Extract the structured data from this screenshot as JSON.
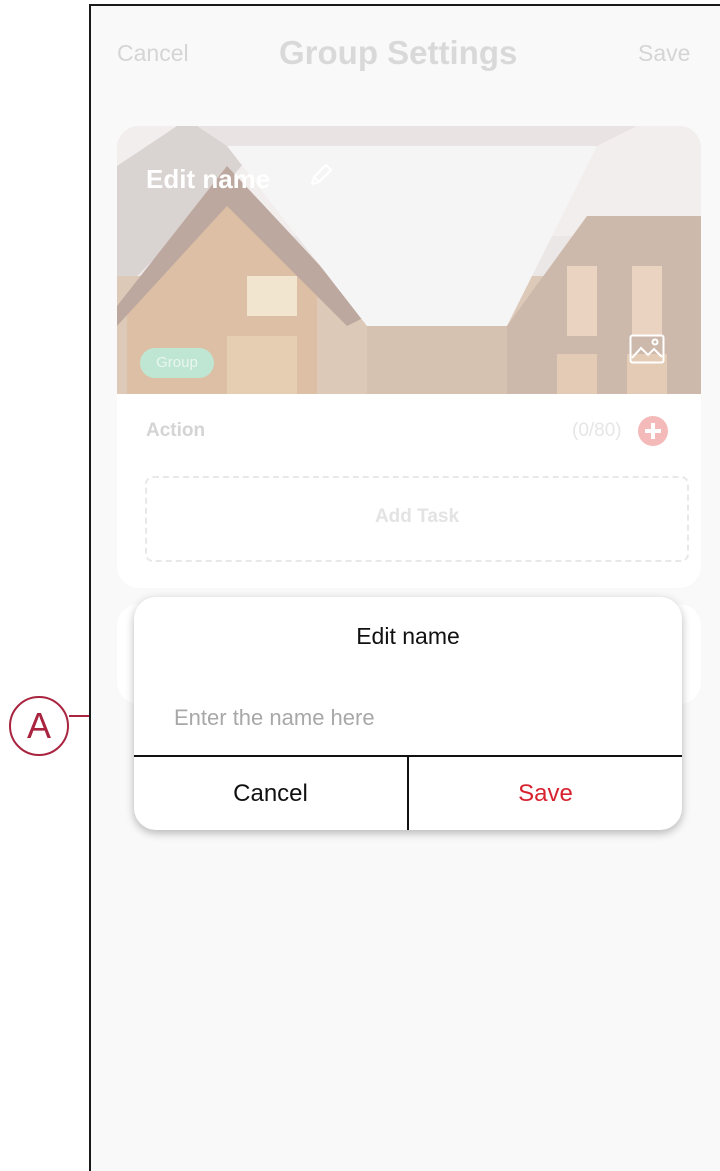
{
  "nav": {
    "cancel_label": "Cancel",
    "title": "Group Settings",
    "save_label": "Save"
  },
  "card": {
    "banner_title": "Edit name",
    "badge": "Group",
    "action_label": "Action",
    "action_count": "(0/80)",
    "add_task_label": "Add Task",
    "icons": [
      "pencil-icon",
      "image-icon",
      "plus-icon"
    ]
  },
  "dialog": {
    "title": "Edit name",
    "input_placeholder": "Enter the name here",
    "input_value": "",
    "cancel_label": "Cancel",
    "save_label": "Save"
  },
  "annotation": {
    "callout_letter": "A"
  },
  "colors": {
    "accent_red": "#d8232f",
    "callout": "#a8243f",
    "badge": "#bfe6d3"
  }
}
